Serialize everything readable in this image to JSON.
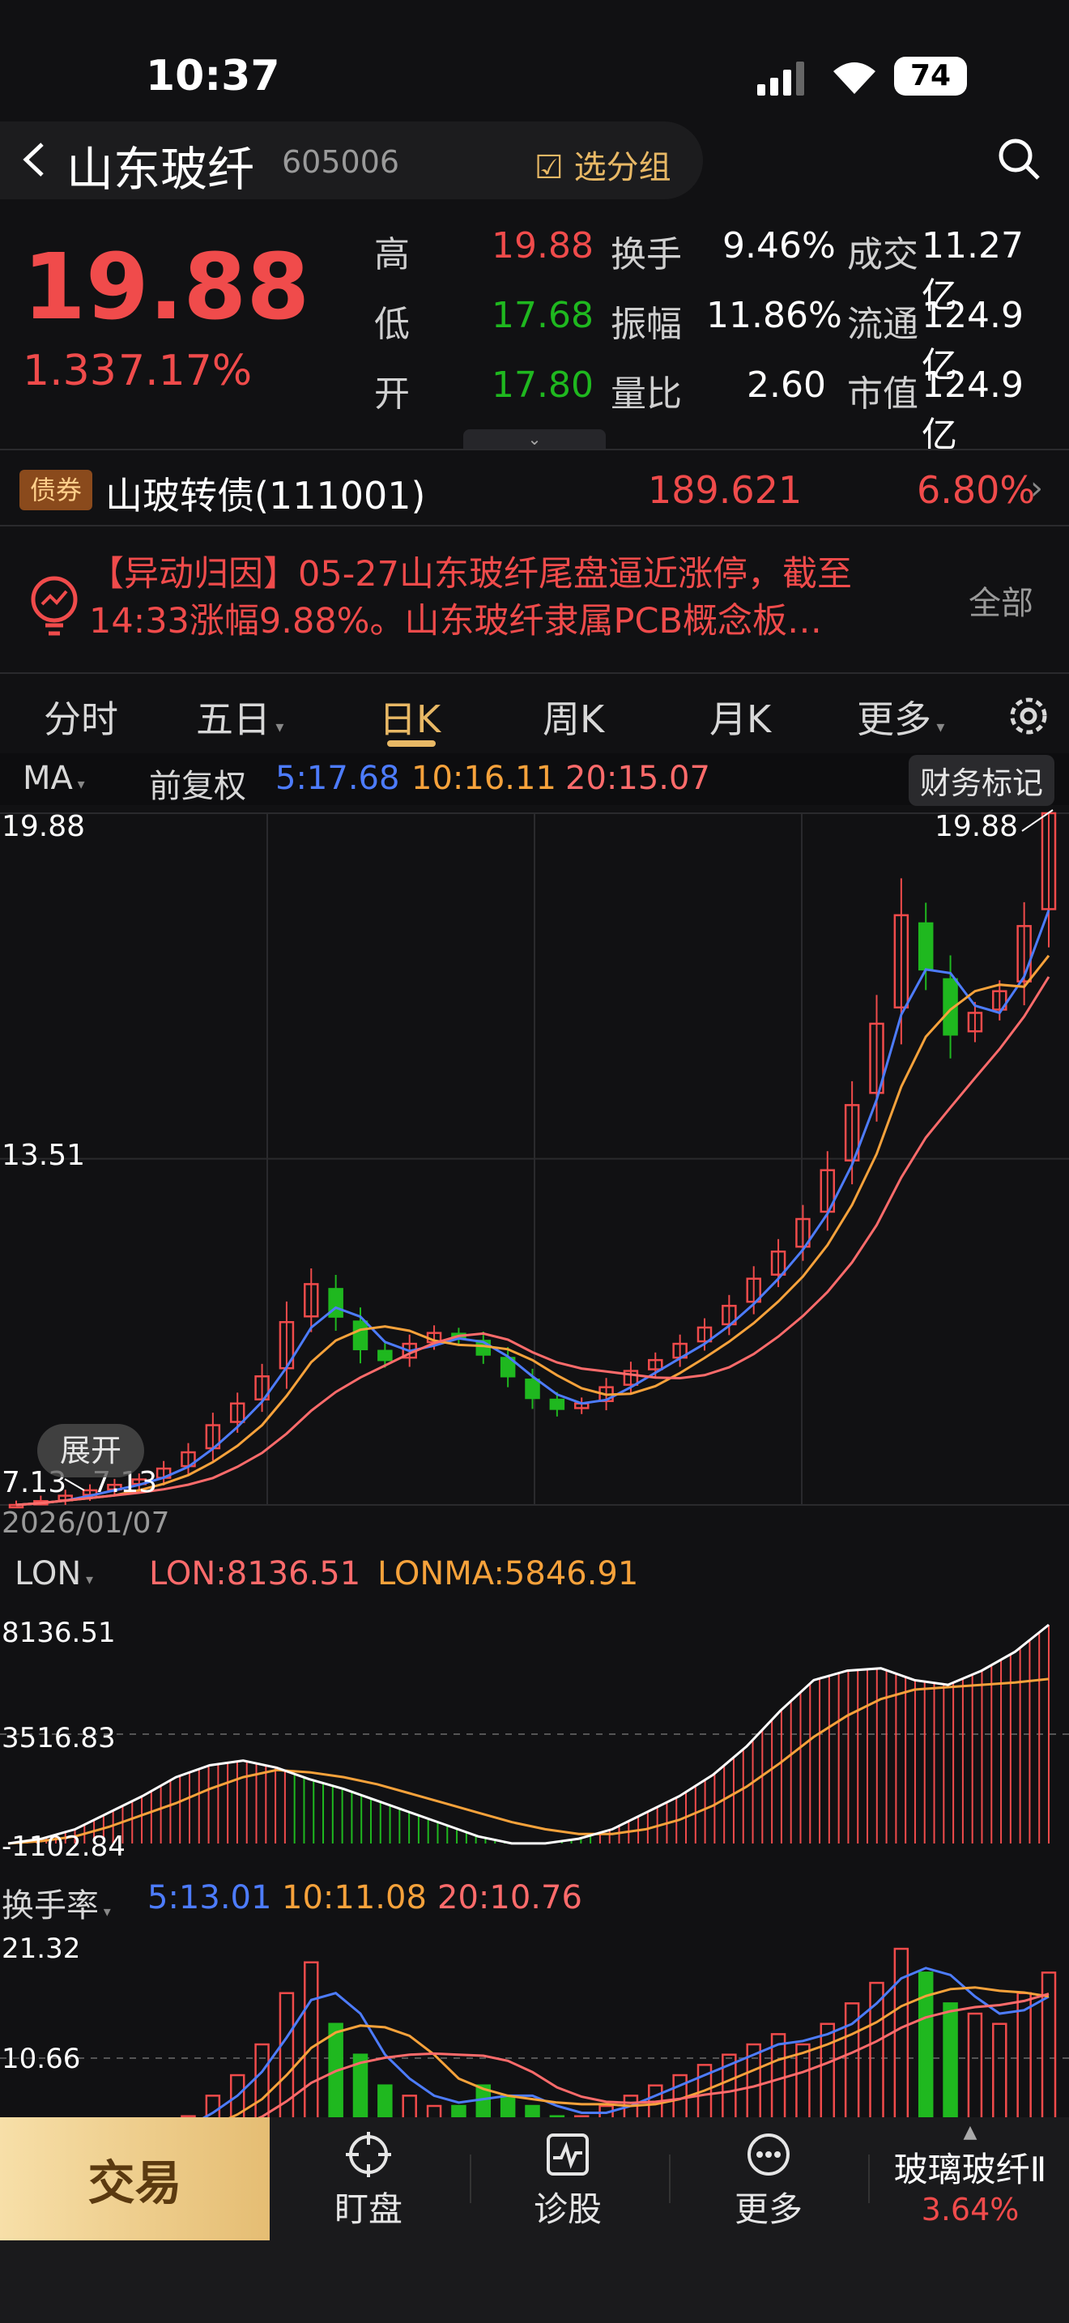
{
  "status": {
    "time": "10:37",
    "battery": "74"
  },
  "header": {
    "title": "山东玻纤",
    "code": "605006",
    "add_group": "选分组"
  },
  "quote": {
    "price": "19.88",
    "change": "1.33",
    "change_pct": "7.17%",
    "rows": [
      {
        "l1": "高",
        "v1": "19.88",
        "l2": "换手",
        "v2": "9.46%",
        "l3": "成交",
        "v3": "11.27亿"
      },
      {
        "l1": "低",
        "v1": "17.68",
        "l2": "振幅",
        "v2": "11.86%",
        "l3": "流通",
        "v3": "124.9亿"
      },
      {
        "l1": "开",
        "v1": "17.80",
        "l2": "量比",
        "v2": "2.60",
        "l3": "市值",
        "v3": "124.9亿"
      }
    ]
  },
  "bond": {
    "badge": "债券",
    "name": "山玻转债(111001)",
    "price": "189.621",
    "pct": "6.80%"
  },
  "news": {
    "text": "【异动归因】05-27山东玻纤尾盘逼近涨停，截至14:33涨幅9.88%。山东玻纤隶属PCB概念板…",
    "all": "全部"
  },
  "tabs": [
    "分时",
    "五日",
    "日K",
    "周K",
    "月K",
    "更多"
  ],
  "ma_bar": {
    "ma": "MA",
    "adj": "前复权",
    "ma5": "5:17.68",
    "ma10": "10:16.11",
    "ma20": "20:15.07",
    "fin": "财务标记"
  },
  "kline": {
    "y_top": "19.88",
    "y_mid": "13.51",
    "y_low": "7.13",
    "high_label": "19.88",
    "low_label": "7.13",
    "start_date": "2026/01/07",
    "expand": "展开"
  },
  "lon": {
    "name": "LON",
    "lon": "LON:8136.51",
    "lonma": "LONMA:5846.91",
    "y_top": "8136.51",
    "y_mid": "3516.83",
    "y_low": "-1102.84"
  },
  "turnover": {
    "name": "换手率",
    "ma5": "5:13.01",
    "ma10": "10:11.08",
    "ma20": "20:10.76",
    "y_top": "21.32",
    "y_mid": "10.66"
  },
  "bottom": {
    "trade": "交易",
    "watch": "盯盘",
    "diagnose": "诊股",
    "more": "更多",
    "sector": "玻璃玻纤Ⅱ",
    "sector_pct": "3.64%"
  },
  "chart_data": [
    {
      "type": "candlestick",
      "title": "日K",
      "ylim": [
        7.13,
        19.88
      ],
      "ma": {
        "MA5": 17.68,
        "MA10": 16.11,
        "MA20": 15.07
      },
      "series": [
        {
          "name": "close",
          "values": [
            7.13,
            7.2,
            7.3,
            7.4,
            7.5,
            7.6,
            7.8,
            8.1,
            8.6,
            9.0,
            9.5,
            10.5,
            11.2,
            10.6,
            10.0,
            9.8,
            10.1,
            10.3,
            10.2,
            9.9,
            9.5,
            9.1,
            8.9,
            9.0,
            9.3,
            9.6,
            9.8,
            10.1,
            10.4,
            10.8,
            11.3,
            11.8,
            12.4,
            13.3,
            14.5,
            16.0,
            18.0,
            17.0,
            15.8,
            16.2,
            16.6,
            17.8,
            19.88
          ]
        }
      ]
    },
    {
      "type": "line",
      "title": "LON",
      "ylim": [
        -1102.84,
        8136.51
      ],
      "series": [
        {
          "name": "LON",
          "values": [
            -1102.84,
            -900,
            -500,
            200,
            900,
            1700,
            2200,
            2400,
            2100,
            1600,
            1200,
            700,
            200,
            -300,
            -800,
            -1100,
            -1100,
            -900,
            -500,
            200,
            900,
            1800,
            3000,
            4500,
            5800,
            6200,
            6300,
            5800,
            5600,
            6200,
            7000,
            8136.51
          ]
        },
        {
          "name": "LONMA",
          "values": [
            -1102.84,
            -1000,
            -800,
            -400,
            100,
            600,
            1200,
            1700,
            2000,
            1900,
            1700,
            1400,
            1000,
            600,
            200,
            -200,
            -500,
            -700,
            -700,
            -500,
            -100,
            500,
            1300,
            2300,
            3400,
            4300,
            5000,
            5400,
            5500,
            5600,
            5700,
            5846.91
          ]
        }
      ]
    },
    {
      "type": "bar",
      "title": "换手率",
      "ylim": [
        0,
        21.32
      ],
      "ma": {
        "MA5": 13.01,
        "MA10": 11.08,
        "MA20": 10.76
      }
    }
  ],
  "colors": {
    "up": "#f04b4b",
    "down": "#1fb81f",
    "ma5": "#4d7cff",
    "ma10": "#f7a23b",
    "ma20": "#ff6b6b",
    "accent": "#e8b865"
  }
}
